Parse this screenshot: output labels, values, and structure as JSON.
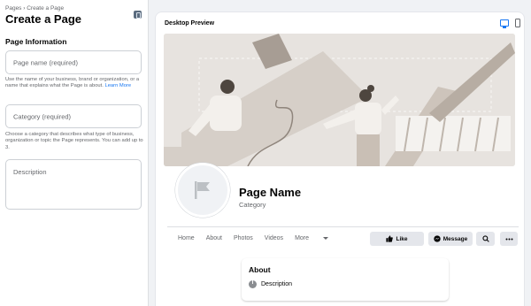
{
  "left_panel": {
    "breadcrumb": "Pages › Create a Page",
    "title": "Create a Page",
    "section_title": "Page Information",
    "page_name_placeholder": "Page name (required)",
    "page_name_help": "Use the name of your business, brand or organization, or a name that explains what the Page is about.",
    "learn_more": "Learn More",
    "category_placeholder": "Category (required)",
    "category_help": "Choose a category that describes what type of business, organization or topic the Page represents. You can add up to 3.",
    "description_placeholder": "Description"
  },
  "preview": {
    "title": "Desktop Preview",
    "page_name": "Page Name",
    "category": "Category",
    "tabs": [
      "Home",
      "About",
      "Photos",
      "Videos",
      "More"
    ],
    "buttons": {
      "like": "Like",
      "message": "Message"
    },
    "about": {
      "title": "About",
      "description": "Description"
    }
  },
  "colors": {
    "accent": "#1877f2",
    "muted": "#65676b",
    "button_bg": "#e4e6eb"
  },
  "icons": [
    "panel-toggle-icon",
    "desktop-icon",
    "mobile-icon",
    "flag-icon",
    "thumbs-up-icon",
    "messenger-icon",
    "search-icon",
    "ellipsis-icon",
    "info-icon",
    "caret-down-icon"
  ]
}
